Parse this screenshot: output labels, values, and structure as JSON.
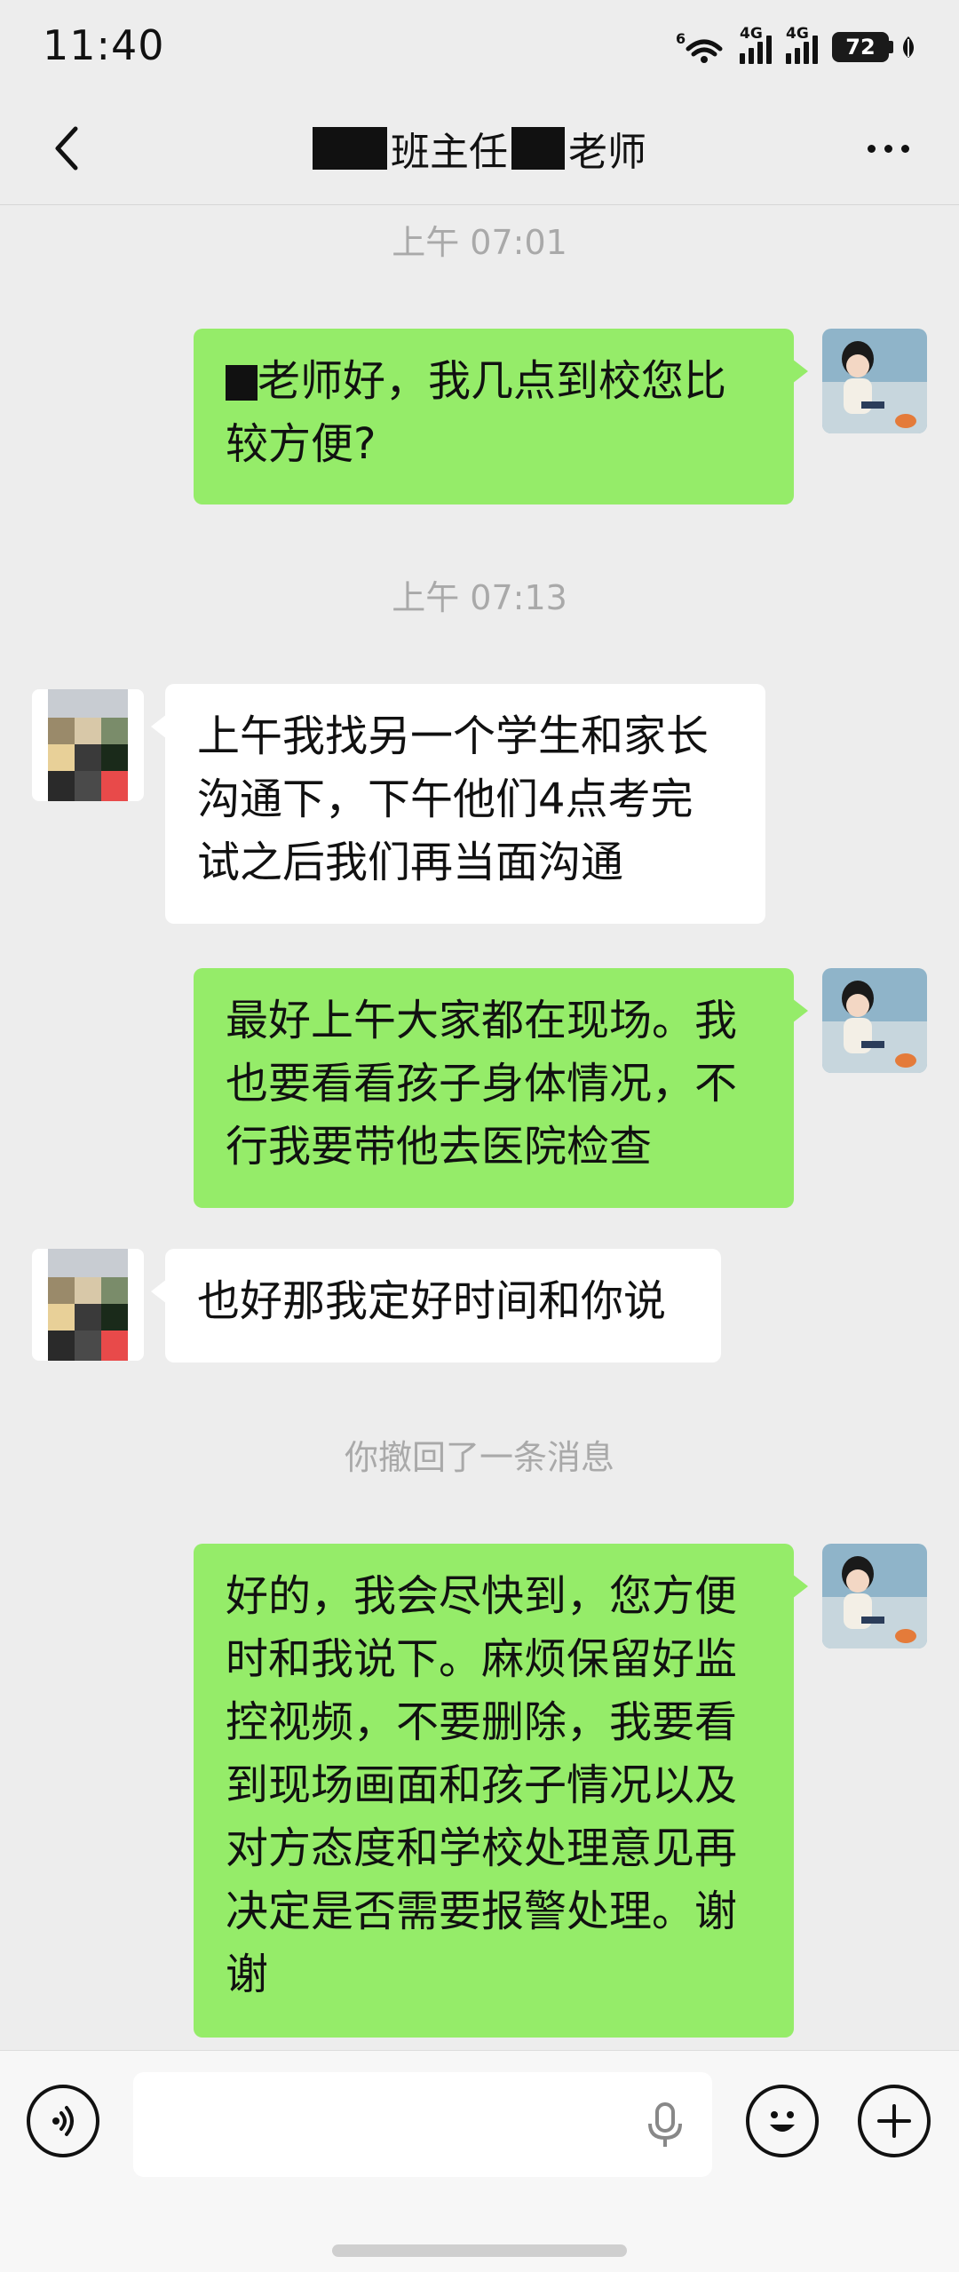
{
  "status_bar": {
    "time": "11:40",
    "net1": "6",
    "sig1": "4G",
    "sig2": "4G",
    "battery": "72"
  },
  "nav": {
    "title_mid": "班主任",
    "title_end": "老师"
  },
  "messages": [
    {
      "type": "timestamp",
      "text": "上午 07:01"
    },
    {
      "type": "out",
      "line1_prefix": "█",
      "line1": "老师好，我几点到校您比",
      "line2": "较方便?"
    },
    {
      "type": "timestamp",
      "text": "上午 07:13"
    },
    {
      "type": "in",
      "lines": [
        "上午我找另一个学生和家长",
        "沟通下，下午他们4点考完",
        "试之后我们再当面沟通"
      ]
    },
    {
      "type": "out",
      "lines": [
        "最好上午大家都在现场。我",
        "也要看看孩子身体情况，不",
        "行我要带他去医院检查"
      ]
    },
    {
      "type": "in",
      "lines": [
        "也好那我定好时间和你说"
      ]
    },
    {
      "type": "system",
      "text": "你撤回了一条消息"
    },
    {
      "type": "out",
      "lines": [
        "好的，我会尽快到，您方便",
        "时和我说下。麻烦保留好监",
        "控视频，不要删除，我要看",
        "到现场画面和孩子情况以及",
        "对方态度和学校处理意见再",
        "决定是否需要报警处理。谢",
        "谢"
      ]
    }
  ],
  "colors": {
    "bubble_out": "#95ec69",
    "bubble_in": "#ffffff",
    "background": "#ededed"
  },
  "icons": {
    "back": "chevron-left-icon",
    "more": "more-dots-icon",
    "voice": "voice-icon",
    "emoji": "emoji-icon",
    "plus": "plus-icon",
    "mic": "mic-icon"
  }
}
